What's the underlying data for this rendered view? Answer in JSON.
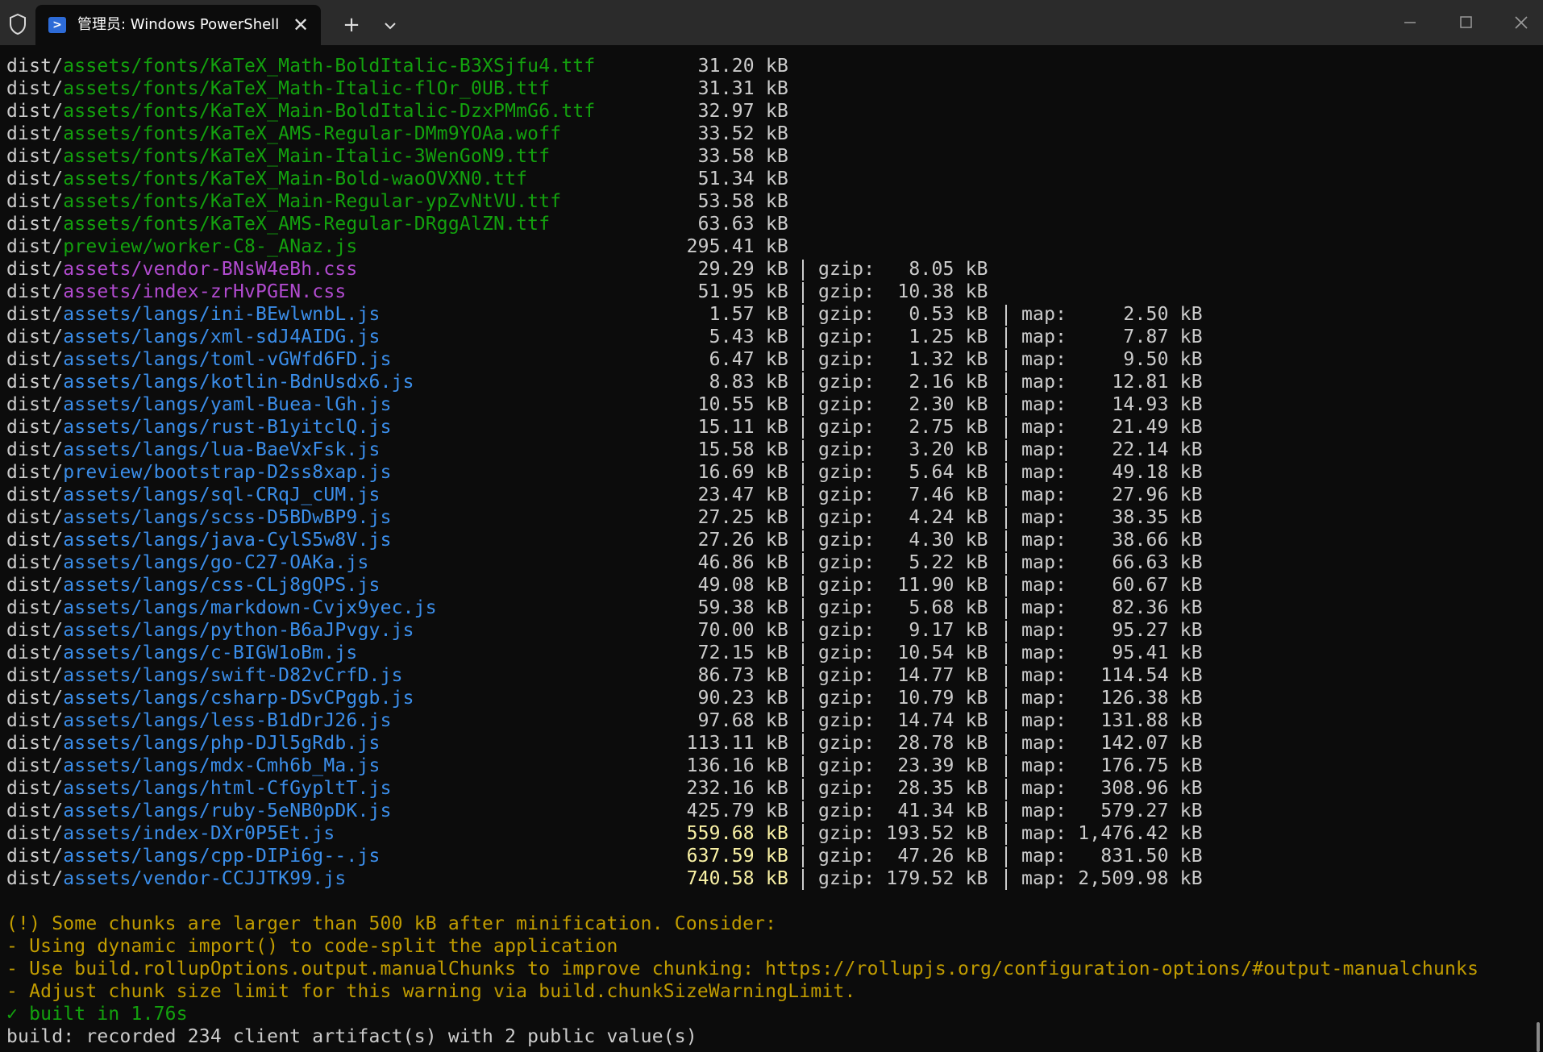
{
  "window": {
    "tab_title": "管理员: Windows PowerShell",
    "tab_icon_glyph": ">",
    "new_tab_glyph": "+",
    "close_tab_glyph": "✕"
  },
  "colors": {
    "background": "#0c0c0c",
    "titlebar": "#2b2b2b",
    "green": "#13a10e",
    "magenta": "#b24bd0",
    "blue": "#3b8eea",
    "yellow_size": "#f9f1a5",
    "warning": "#c19c00"
  },
  "terminal": {
    "entries": [
      {
        "prefix": "dist/",
        "path": "assets/fonts/KaTeX_Math-BoldItalic-B3XSjfu4.ttf",
        "color": "green",
        "size": "31.20 kB"
      },
      {
        "prefix": "dist/",
        "path": "assets/fonts/KaTeX_Math-Italic-flOr_0UB.ttf",
        "color": "green",
        "size": "31.31 kB"
      },
      {
        "prefix": "dist/",
        "path": "assets/fonts/KaTeX_Main-BoldItalic-DzxPMmG6.ttf",
        "color": "green",
        "size": "32.97 kB"
      },
      {
        "prefix": "dist/",
        "path": "assets/fonts/KaTeX_AMS-Regular-DMm9YOAa.woff",
        "color": "green",
        "size": "33.52 kB"
      },
      {
        "prefix": "dist/",
        "path": "assets/fonts/KaTeX_Main-Italic-3WenGoN9.ttf",
        "color": "green",
        "size": "33.58 kB"
      },
      {
        "prefix": "dist/",
        "path": "assets/fonts/KaTeX_Main-Bold-waoOVXN0.ttf",
        "color": "green",
        "size": "51.34 kB"
      },
      {
        "prefix": "dist/",
        "path": "assets/fonts/KaTeX_Main-Regular-ypZvNtVU.ttf",
        "color": "green",
        "size": "53.58 kB"
      },
      {
        "prefix": "dist/",
        "path": "assets/fonts/KaTeX_AMS-Regular-DRggAlZN.ttf",
        "color": "green",
        "size": "63.63 kB"
      },
      {
        "prefix": "dist/",
        "path": "preview/worker-C8-_ANaz.js",
        "color": "green",
        "size": "295.41 kB"
      },
      {
        "prefix": "dist/",
        "path": "assets/vendor-BNsW4eBh.css",
        "color": "magenta",
        "size": "29.29 kB",
        "gzip": "gzip:   8.05 kB"
      },
      {
        "prefix": "dist/",
        "path": "assets/index-zrHvPGEN.css",
        "color": "magenta",
        "size": "51.95 kB",
        "gzip": "gzip:  10.38 kB"
      },
      {
        "prefix": "dist/",
        "path": "assets/langs/ini-BEwlwnbL.js",
        "color": "blue",
        "size": "1.57 kB",
        "gzip": "gzip:   0.53 kB",
        "map": "map:     2.50 kB"
      },
      {
        "prefix": "dist/",
        "path": "assets/langs/xml-sdJ4AIDG.js",
        "color": "blue",
        "size": "5.43 kB",
        "gzip": "gzip:   1.25 kB",
        "map": "map:     7.87 kB"
      },
      {
        "prefix": "dist/",
        "path": "assets/langs/toml-vGWfd6FD.js",
        "color": "blue",
        "size": "6.47 kB",
        "gzip": "gzip:   1.32 kB",
        "map": "map:     9.50 kB"
      },
      {
        "prefix": "dist/",
        "path": "assets/langs/kotlin-BdnUsdx6.js",
        "color": "blue",
        "size": "8.83 kB",
        "gzip": "gzip:   2.16 kB",
        "map": "map:    12.81 kB"
      },
      {
        "prefix": "dist/",
        "path": "assets/langs/yaml-Buea-lGh.js",
        "color": "blue",
        "size": "10.55 kB",
        "gzip": "gzip:   2.30 kB",
        "map": "map:    14.93 kB"
      },
      {
        "prefix": "dist/",
        "path": "assets/langs/rust-B1yitclQ.js",
        "color": "blue",
        "size": "15.11 kB",
        "gzip": "gzip:   2.75 kB",
        "map": "map:    21.49 kB"
      },
      {
        "prefix": "dist/",
        "path": "assets/langs/lua-BaeVxFsk.js",
        "color": "blue",
        "size": "15.58 kB",
        "gzip": "gzip:   3.20 kB",
        "map": "map:    22.14 kB"
      },
      {
        "prefix": "dist/",
        "path": "preview/bootstrap-D2ss8xap.js",
        "color": "blue",
        "size": "16.69 kB",
        "gzip": "gzip:   5.64 kB",
        "map": "map:    49.18 kB"
      },
      {
        "prefix": "dist/",
        "path": "assets/langs/sql-CRqJ_cUM.js",
        "color": "blue",
        "size": "23.47 kB",
        "gzip": "gzip:   7.46 kB",
        "map": "map:    27.96 kB"
      },
      {
        "prefix": "dist/",
        "path": "assets/langs/scss-D5BDwBP9.js",
        "color": "blue",
        "size": "27.25 kB",
        "gzip": "gzip:   4.24 kB",
        "map": "map:    38.35 kB"
      },
      {
        "prefix": "dist/",
        "path": "assets/langs/java-CylS5w8V.js",
        "color": "blue",
        "size": "27.26 kB",
        "gzip": "gzip:   4.30 kB",
        "map": "map:    38.66 kB"
      },
      {
        "prefix": "dist/",
        "path": "assets/langs/go-C27-OAKa.js",
        "color": "blue",
        "size": "46.86 kB",
        "gzip": "gzip:   5.22 kB",
        "map": "map:    66.63 kB"
      },
      {
        "prefix": "dist/",
        "path": "assets/langs/css-CLj8gQPS.js",
        "color": "blue",
        "size": "49.08 kB",
        "gzip": "gzip:  11.90 kB",
        "map": "map:    60.67 kB"
      },
      {
        "prefix": "dist/",
        "path": "assets/langs/markdown-Cvjx9yec.js",
        "color": "blue",
        "size": "59.38 kB",
        "gzip": "gzip:   5.68 kB",
        "map": "map:    82.36 kB"
      },
      {
        "prefix": "dist/",
        "path": "assets/langs/python-B6aJPvgy.js",
        "color": "blue",
        "size": "70.00 kB",
        "gzip": "gzip:   9.17 kB",
        "map": "map:    95.27 kB"
      },
      {
        "prefix": "dist/",
        "path": "assets/langs/c-BIGW1oBm.js",
        "color": "blue",
        "size": "72.15 kB",
        "gzip": "gzip:  10.54 kB",
        "map": "map:    95.41 kB"
      },
      {
        "prefix": "dist/",
        "path": "assets/langs/swift-D82vCrfD.js",
        "color": "blue",
        "size": "86.73 kB",
        "gzip": "gzip:  14.77 kB",
        "map": "map:   114.54 kB"
      },
      {
        "prefix": "dist/",
        "path": "assets/langs/csharp-DSvCPggb.js",
        "color": "blue",
        "size": "90.23 kB",
        "gzip": "gzip:  10.79 kB",
        "map": "map:   126.38 kB"
      },
      {
        "prefix": "dist/",
        "path": "assets/langs/less-B1dDrJ26.js",
        "color": "blue",
        "size": "97.68 kB",
        "gzip": "gzip:  14.74 kB",
        "map": "map:   131.88 kB"
      },
      {
        "prefix": "dist/",
        "path": "assets/langs/php-DJl5gRdb.js",
        "color": "blue",
        "size": "113.11 kB",
        "gzip": "gzip:  28.78 kB",
        "map": "map:   142.07 kB"
      },
      {
        "prefix": "dist/",
        "path": "assets/langs/mdx-Cmh6b_Ma.js",
        "color": "blue",
        "size": "136.16 kB",
        "gzip": "gzip:  23.39 kB",
        "map": "map:   176.75 kB"
      },
      {
        "prefix": "dist/",
        "path": "assets/langs/html-CfGypltT.js",
        "color": "blue",
        "size": "232.16 kB",
        "gzip": "gzip:  28.35 kB",
        "map": "map:   308.96 kB"
      },
      {
        "prefix": "dist/",
        "path": "assets/langs/ruby-5eNB0pDK.js",
        "color": "blue",
        "size": "425.79 kB",
        "gzip": "gzip:  41.34 kB",
        "map": "map:   579.27 kB"
      },
      {
        "prefix": "dist/",
        "path": "assets/index-DXr0P5Et.js",
        "color": "blue",
        "size": "559.68 kB",
        "big": true,
        "gzip": "gzip: 193.52 kB",
        "map": "map: 1,476.42 kB"
      },
      {
        "prefix": "dist/",
        "path": "assets/langs/cpp-DIPi6g--.js",
        "color": "blue",
        "size": "637.59 kB",
        "big": true,
        "gzip": "gzip:  47.26 kB",
        "map": "map:   831.50 kB"
      },
      {
        "prefix": "dist/",
        "path": "assets/vendor-CCJJTK99.js",
        "color": "blue",
        "size": "740.58 kB",
        "big": true,
        "gzip": "gzip: 179.52 kB",
        "map": "map: 2,509.98 kB"
      }
    ],
    "messages": [
      {
        "text": "",
        "style": "plain"
      },
      {
        "text": "(!) Some chunks are larger than 500 kB after minification. Consider:",
        "style": "warn"
      },
      {
        "text": "- Using dynamic import() to code-split the application",
        "style": "warn"
      },
      {
        "text": "- Use build.rollupOptions.output.manualChunks to improve chunking: https://rollupjs.org/configuration-options/#output-manualchunks",
        "style": "warn"
      },
      {
        "text": "- Adjust chunk size limit for this warning via build.chunkSizeWarningLimit.",
        "style": "warn"
      },
      {
        "text": "✓ built in 1.76s",
        "style": "ok"
      },
      {
        "text": "build: recorded 234 client artifact(s) with 2 public value(s)",
        "style": "plain"
      }
    ]
  }
}
